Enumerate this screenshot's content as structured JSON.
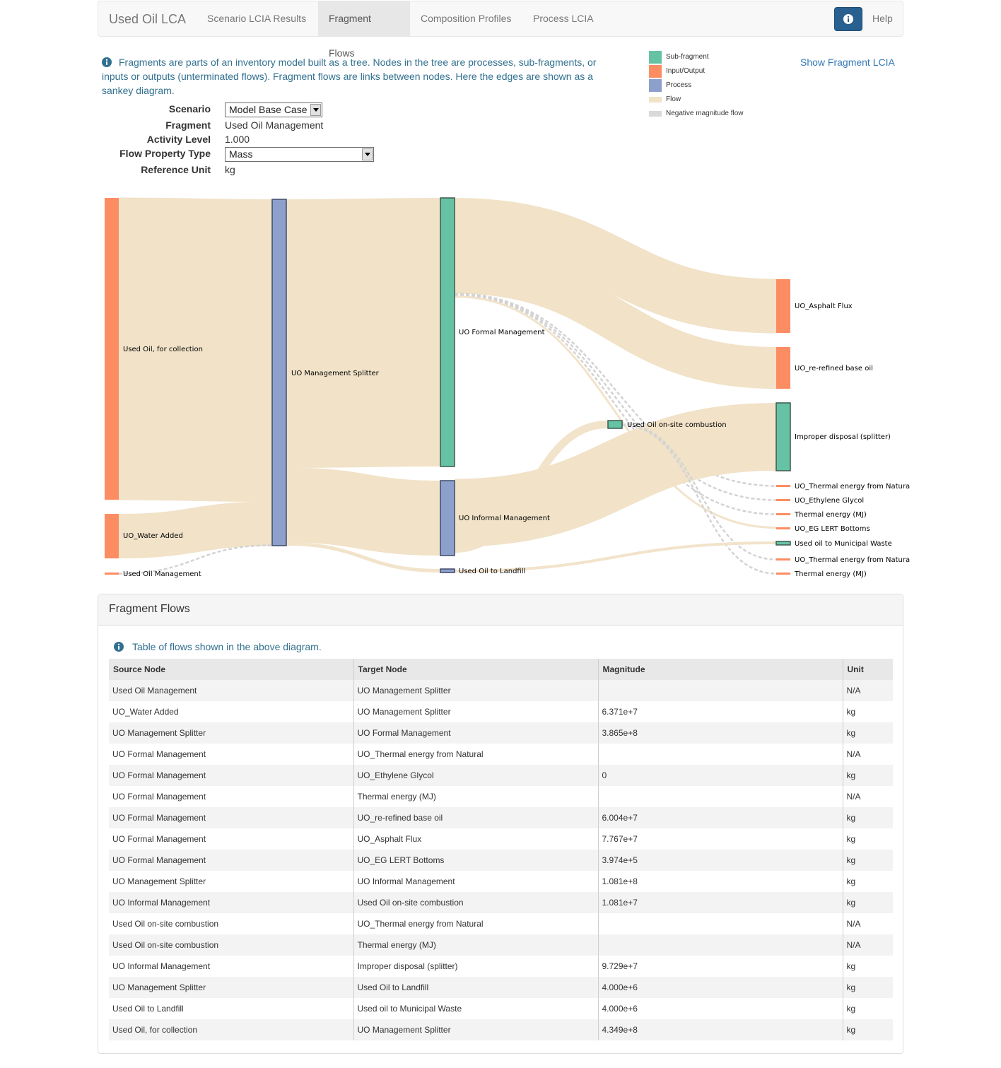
{
  "navbar": {
    "brand": "Used Oil LCA",
    "tabs": [
      {
        "label": "Scenario LCIA Results"
      },
      {
        "label": "Fragment Flows"
      },
      {
        "label": "Composition Profiles"
      },
      {
        "label": "Process LCIA"
      }
    ],
    "active_tab": "Fragment Flows",
    "info_icon": "info-circle-icon",
    "help_label": "Help"
  },
  "intro": {
    "text": "Fragments are parts of an inventory model built as a tree. Nodes in the tree are processes, sub-fragments, or inputs or outputs (unterminated flows). Fragment flows are links between nodes. Here the edges are shown as a sankey diagram.",
    "icon": "info-circle-icon"
  },
  "form": {
    "scenario_label": "Scenario",
    "scenario_value": "Model Base Case",
    "fragment_label": "Fragment",
    "fragment_value": "Used Oil Management",
    "activity_label": "Activity Level",
    "activity_value": "1.000",
    "flow_property_label": "Flow Property Type",
    "flow_property_value": "Mass",
    "reference_unit_label": "Reference Unit",
    "reference_unit_value": "kg"
  },
  "legend": [
    {
      "label": "Sub-fragment",
      "color": "#66c2a5"
    },
    {
      "label": "Input/Output",
      "color": "#fc8d62"
    },
    {
      "label": "Process",
      "color": "#8da0cb"
    },
    {
      "label": "Flow",
      "color": "#f1e2c8"
    },
    {
      "label": "Negative magnitude flow",
      "color": "#d9d9d9"
    }
  ],
  "show_lcia_label": "Show Fragment LCIA",
  "sankey": {
    "colors": {
      "subfragment": "#66c2a5",
      "io": "#fc8d62",
      "process": "#8da0cb",
      "flow": "#f1e2c8",
      "negative": "#d3d3d3"
    },
    "nodes": [
      {
        "label": "Used Oil, for collection"
      },
      {
        "label": "UO_Water Added"
      },
      {
        "label": "Used Oil Management"
      },
      {
        "label": "UO Management Splitter"
      },
      {
        "label": "UO Formal Management"
      },
      {
        "label": "UO Informal Management"
      },
      {
        "label": "Used Oil to Landfill"
      },
      {
        "label": "Used Oil on-site combustion"
      },
      {
        "label": "UO_Asphalt Flux"
      },
      {
        "label": "UO_re-refined base oil"
      },
      {
        "label": "Improper disposal (splitter)"
      },
      {
        "label": "UO_Thermal energy from Natura"
      },
      {
        "label": "UO_Ethylene Glycol"
      },
      {
        "label": "Thermal energy (MJ)"
      },
      {
        "label": "UO_EG LERT Bottoms"
      },
      {
        "label": "Used oil to Municipal Waste"
      },
      {
        "label": "UO_Thermal energy from Natura"
      },
      {
        "label": "Thermal energy (MJ)"
      }
    ]
  },
  "panel": {
    "title": "Fragment Flows",
    "note": "Table of flows shown in the above diagram.",
    "note_icon": "info-circle-icon",
    "columns": [
      "Source Node",
      "Target Node",
      "Magnitude",
      "Unit"
    ],
    "rows": [
      [
        "Used Oil Management",
        "UO Management Splitter",
        "",
        "N/A"
      ],
      [
        "UO_Water Added",
        "UO Management Splitter",
        "6.371e+7",
        "kg"
      ],
      [
        "UO Management Splitter",
        "UO Formal Management",
        "3.865e+8",
        "kg"
      ],
      [
        "UO Formal Management",
        "UO_Thermal energy from Natural",
        "",
        "N/A"
      ],
      [
        "UO Formal Management",
        "UO_Ethylene Glycol",
        "0",
        "kg"
      ],
      [
        "UO Formal Management",
        "Thermal energy (MJ)",
        "",
        "N/A"
      ],
      [
        "UO Formal Management",
        "UO_re-refined base oil",
        "6.004e+7",
        "kg"
      ],
      [
        "UO Formal Management",
        "UO_Asphalt Flux",
        "7.767e+7",
        "kg"
      ],
      [
        "UO Formal Management",
        "UO_EG LERT Bottoms",
        "3.974e+5",
        "kg"
      ],
      [
        "UO Management Splitter",
        "UO Informal Management",
        "1.081e+8",
        "kg"
      ],
      [
        "UO Informal Management",
        "Used Oil on-site combustion",
        "1.081e+7",
        "kg"
      ],
      [
        "Used Oil on-site combustion",
        "UO_Thermal energy from Natural",
        "",
        "N/A"
      ],
      [
        "Used Oil on-site combustion",
        "Thermal energy (MJ)",
        "",
        "N/A"
      ],
      [
        "UO Informal Management",
        "Improper disposal (splitter)",
        "9.729e+7",
        "kg"
      ],
      [
        "UO Management Splitter",
        "Used Oil to Landfill",
        "4.000e+6",
        "kg"
      ],
      [
        "Used Oil to Landfill",
        "Used oil to Municipal Waste",
        "4.000e+6",
        "kg"
      ],
      [
        "Used Oil, for collection",
        "UO Management Splitter",
        "4.349e+8",
        "kg"
      ]
    ]
  }
}
